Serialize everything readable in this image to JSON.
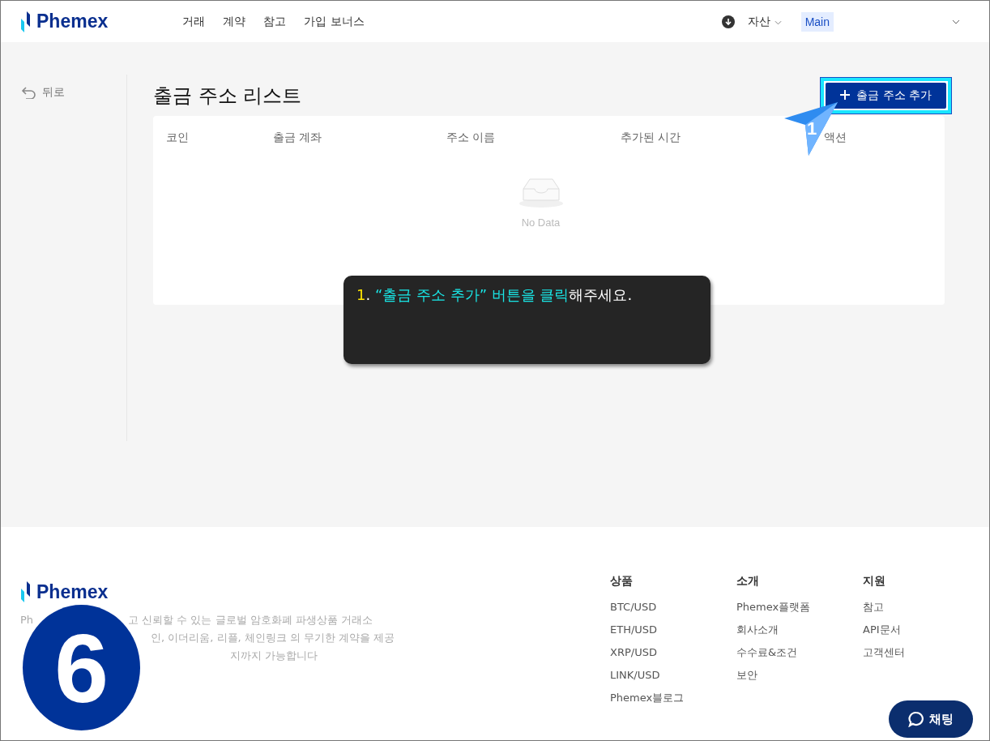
{
  "header": {
    "logo": "Phemex",
    "nav": [
      "거래",
      "계약",
      "참고",
      "가입 보너스"
    ],
    "assets": "자산",
    "account": "Main"
  },
  "back": "뒤로",
  "title": "출금 주소 리스트",
  "add_button": "출금 주소 추가",
  "pointer_badge": "1",
  "table": {
    "columns": [
      "코인",
      "출금 계좌",
      "주소 이름",
      "추가된 시간",
      "액션"
    ],
    "empty": "No Data"
  },
  "tooltip": [
    {
      "kind": "number",
      "text": "1"
    },
    {
      "kind": "plain",
      "text": ". "
    },
    {
      "kind": "highlight",
      "text": "“출금 주소 추가” 버튼을 클릭"
    },
    {
      "kind": "plain",
      "text": "해주세요."
    }
  ],
  "footer": {
    "logo": "Phemex",
    "description": [
      {
        "left": "Ph",
        "right": "고 신뢰할 수 있는 글로벌 암호화폐 파생상품 거래소"
      },
      {
        "right": "인, 이더리움, 리플, 체인링크 의 무기한 계약을 제공"
      },
      {
        "right": "지까지 가능합니다"
      }
    ],
    "columns": [
      {
        "title": "상품",
        "links": [
          "BTC/USD",
          "ETH/USD",
          "XRP/USD",
          "LINK/USD",
          "Phemex블로그"
        ]
      },
      {
        "title": "소개",
        "links": [
          "Phemex플랫폼",
          "회사소개",
          "수수료&조건",
          "보안"
        ]
      },
      {
        "title": "지원",
        "links": [
          "참고",
          "API문서",
          "고객센터"
        ]
      }
    ]
  },
  "step_badge": "6",
  "chat_button": "채팅"
}
